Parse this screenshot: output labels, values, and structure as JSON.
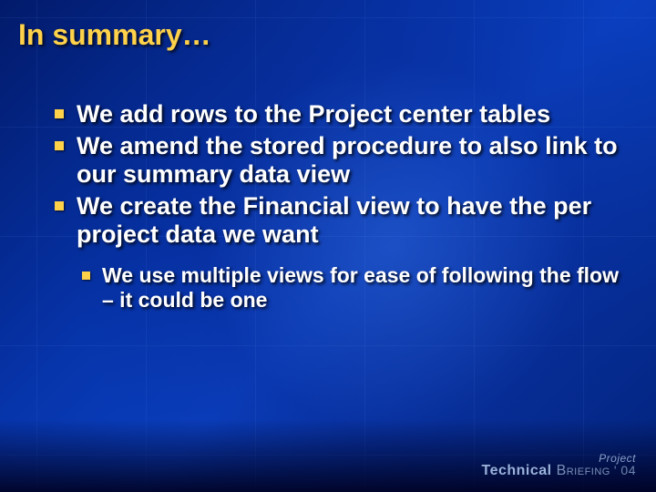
{
  "title": "In summary…",
  "bullets": [
    "We add rows to the Project center tables",
    "We amend the stored procedure to also link to our summary data view",
    "We create the Financial view to have the per project data we want"
  ],
  "sub_bullets": [
    "We use multiple views for ease of following the flow – it could be one"
  ],
  "footer": {
    "product": "Project",
    "word1": "Technical",
    "word2": "Briefing",
    "year": "' 04"
  }
}
